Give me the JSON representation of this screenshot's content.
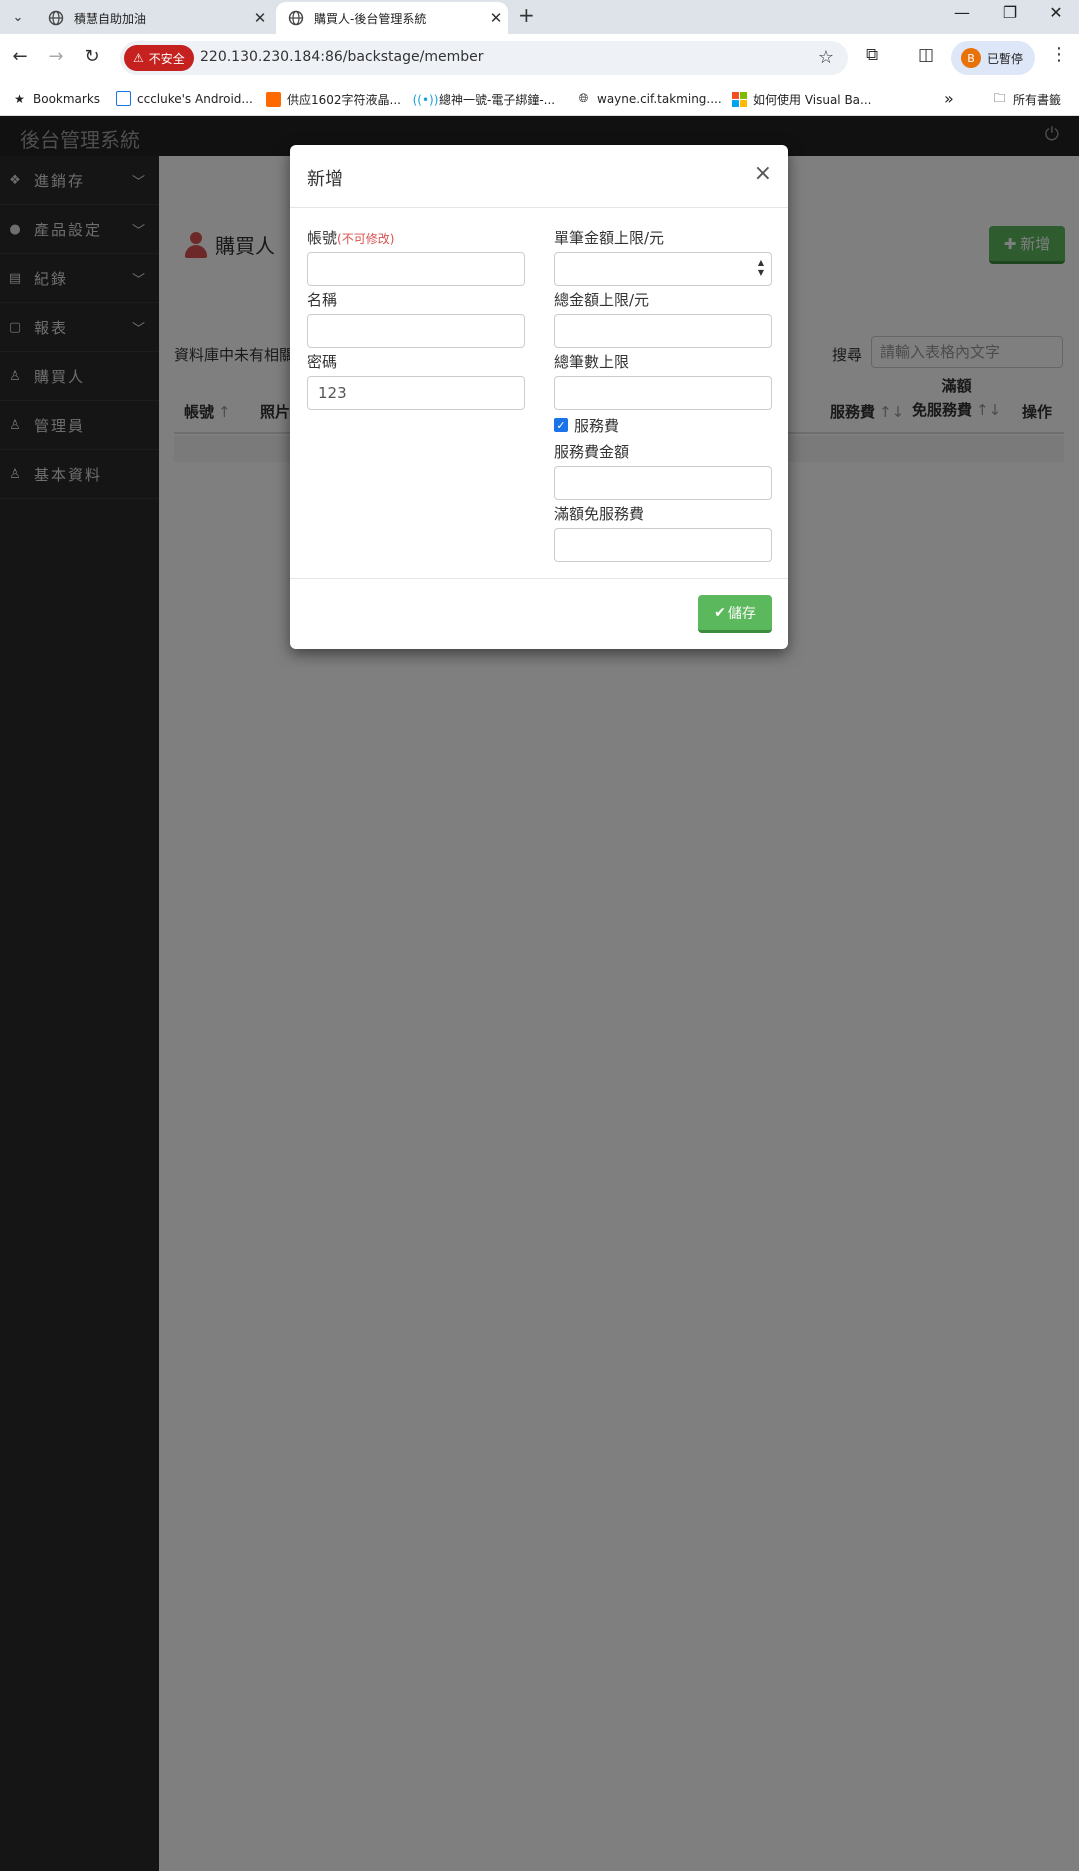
{
  "browser": {
    "tabs": [
      {
        "title": "積慧自助加油"
      },
      {
        "title": "購買人-後台管理系統"
      }
    ],
    "security_label": "不安全",
    "url": "220.130.230.184:86/backstage/member",
    "profile_initial": "B",
    "profile_label": "已暫停",
    "bookmarks": [
      {
        "label": "Bookmarks"
      },
      {
        "label": "cccluke's Android..."
      },
      {
        "label": "供应1602字符液晶..."
      },
      {
        "label": "總神一號-電子綁鐘-..."
      },
      {
        "label": "wayne.cif.takming...."
      },
      {
        "label": "如何使用 Visual Ba..."
      }
    ],
    "all_bookmarks": "所有書籤"
  },
  "app": {
    "brand": "後台管理系統",
    "sidebar": [
      {
        "label": "進銷存",
        "has_children": true
      },
      {
        "label": "產品設定",
        "has_children": true
      },
      {
        "label": "紀錄",
        "has_children": true
      },
      {
        "label": "報表",
        "has_children": true
      },
      {
        "label": "購買人",
        "has_children": false
      },
      {
        "label": "管理員",
        "has_children": false
      },
      {
        "label": "基本資料",
        "has_children": false
      }
    ],
    "page_title": "購買人",
    "add_label": "新增",
    "no_data_text": "資料庫中未有相關資料",
    "search_label": "搜尋",
    "search_placeholder": "請輸入表格內文字",
    "columns": {
      "account": "帳號",
      "photo": "照片",
      "service_fee": "服務費",
      "free_fee_top": "滿額",
      "free_fee_bottom": "免服務費",
      "action": "操作"
    },
    "sort_up": "↑",
    "sort_both": "↑↓"
  },
  "modal": {
    "title": "新增",
    "close": "×",
    "account_label": "帳號",
    "account_note": "(不可修改)",
    "account_value": "",
    "name_label": "名稱",
    "name_value": "",
    "password_label": "密碼",
    "password_value": "123",
    "single_limit_label": "單筆金額上限/元",
    "single_limit_value": "",
    "total_limit_label": "總金額上限/元",
    "total_limit_value": "",
    "count_limit_label": "總筆數上限",
    "count_limit_value": "",
    "service_fee_checkbox_label": "服務費",
    "service_fee_checked": true,
    "service_fee_amount_label": "服務費金額",
    "service_fee_amount_value": "",
    "free_threshold_label": "滿額免服務費",
    "free_threshold_value": "",
    "save_label": "儲存"
  }
}
